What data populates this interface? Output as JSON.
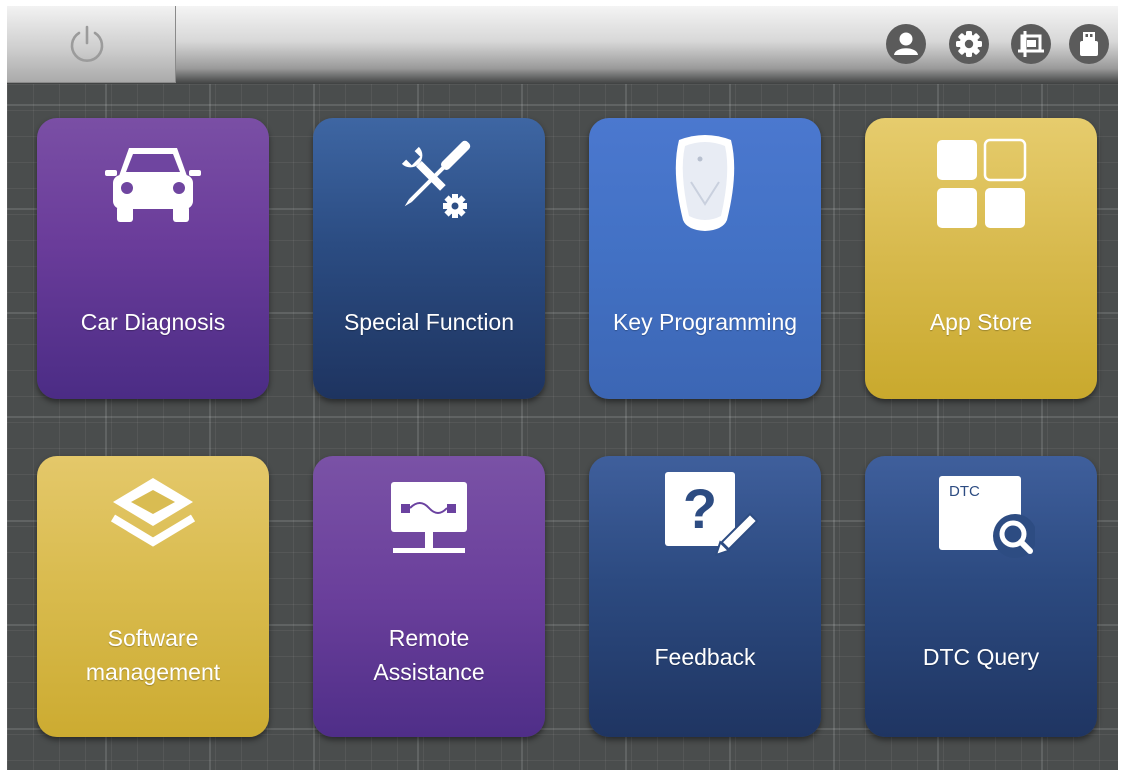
{
  "topbar": {
    "power_icon": "power-icon",
    "icons": [
      "user-icon",
      "gear-icon",
      "crop-icon",
      "usb-icon"
    ]
  },
  "tiles": [
    {
      "label": "Car Diagnosis",
      "icon": "car-icon",
      "color": "#6a3c9a"
    },
    {
      "label": "Special Function",
      "icon": "wrench-screwdriver-gear-icon",
      "color": "#2b4c82"
    },
    {
      "label": "Key Programming",
      "icon": "car-key-fob-icon",
      "color": "#4271c4"
    },
    {
      "label": "App Store",
      "icon": "app-grid-icon",
      "color": "#d7b94c"
    },
    {
      "label_line1": "Software",
      "label_line2": "management",
      "icon": "layers-icon",
      "color": "#d8ba4c"
    },
    {
      "label_line1": "Remote",
      "label_line2": "Assistance",
      "icon": "remote-connection-icon",
      "color": "#6a3f9b"
    },
    {
      "label": "Feedback",
      "icon": "question-pencil-icon",
      "color": "#2c4a80"
    },
    {
      "label": "DTC Query",
      "icon_text": "DTC",
      "icon": "dtc-search-icon",
      "color": "#2c4a80"
    }
  ]
}
